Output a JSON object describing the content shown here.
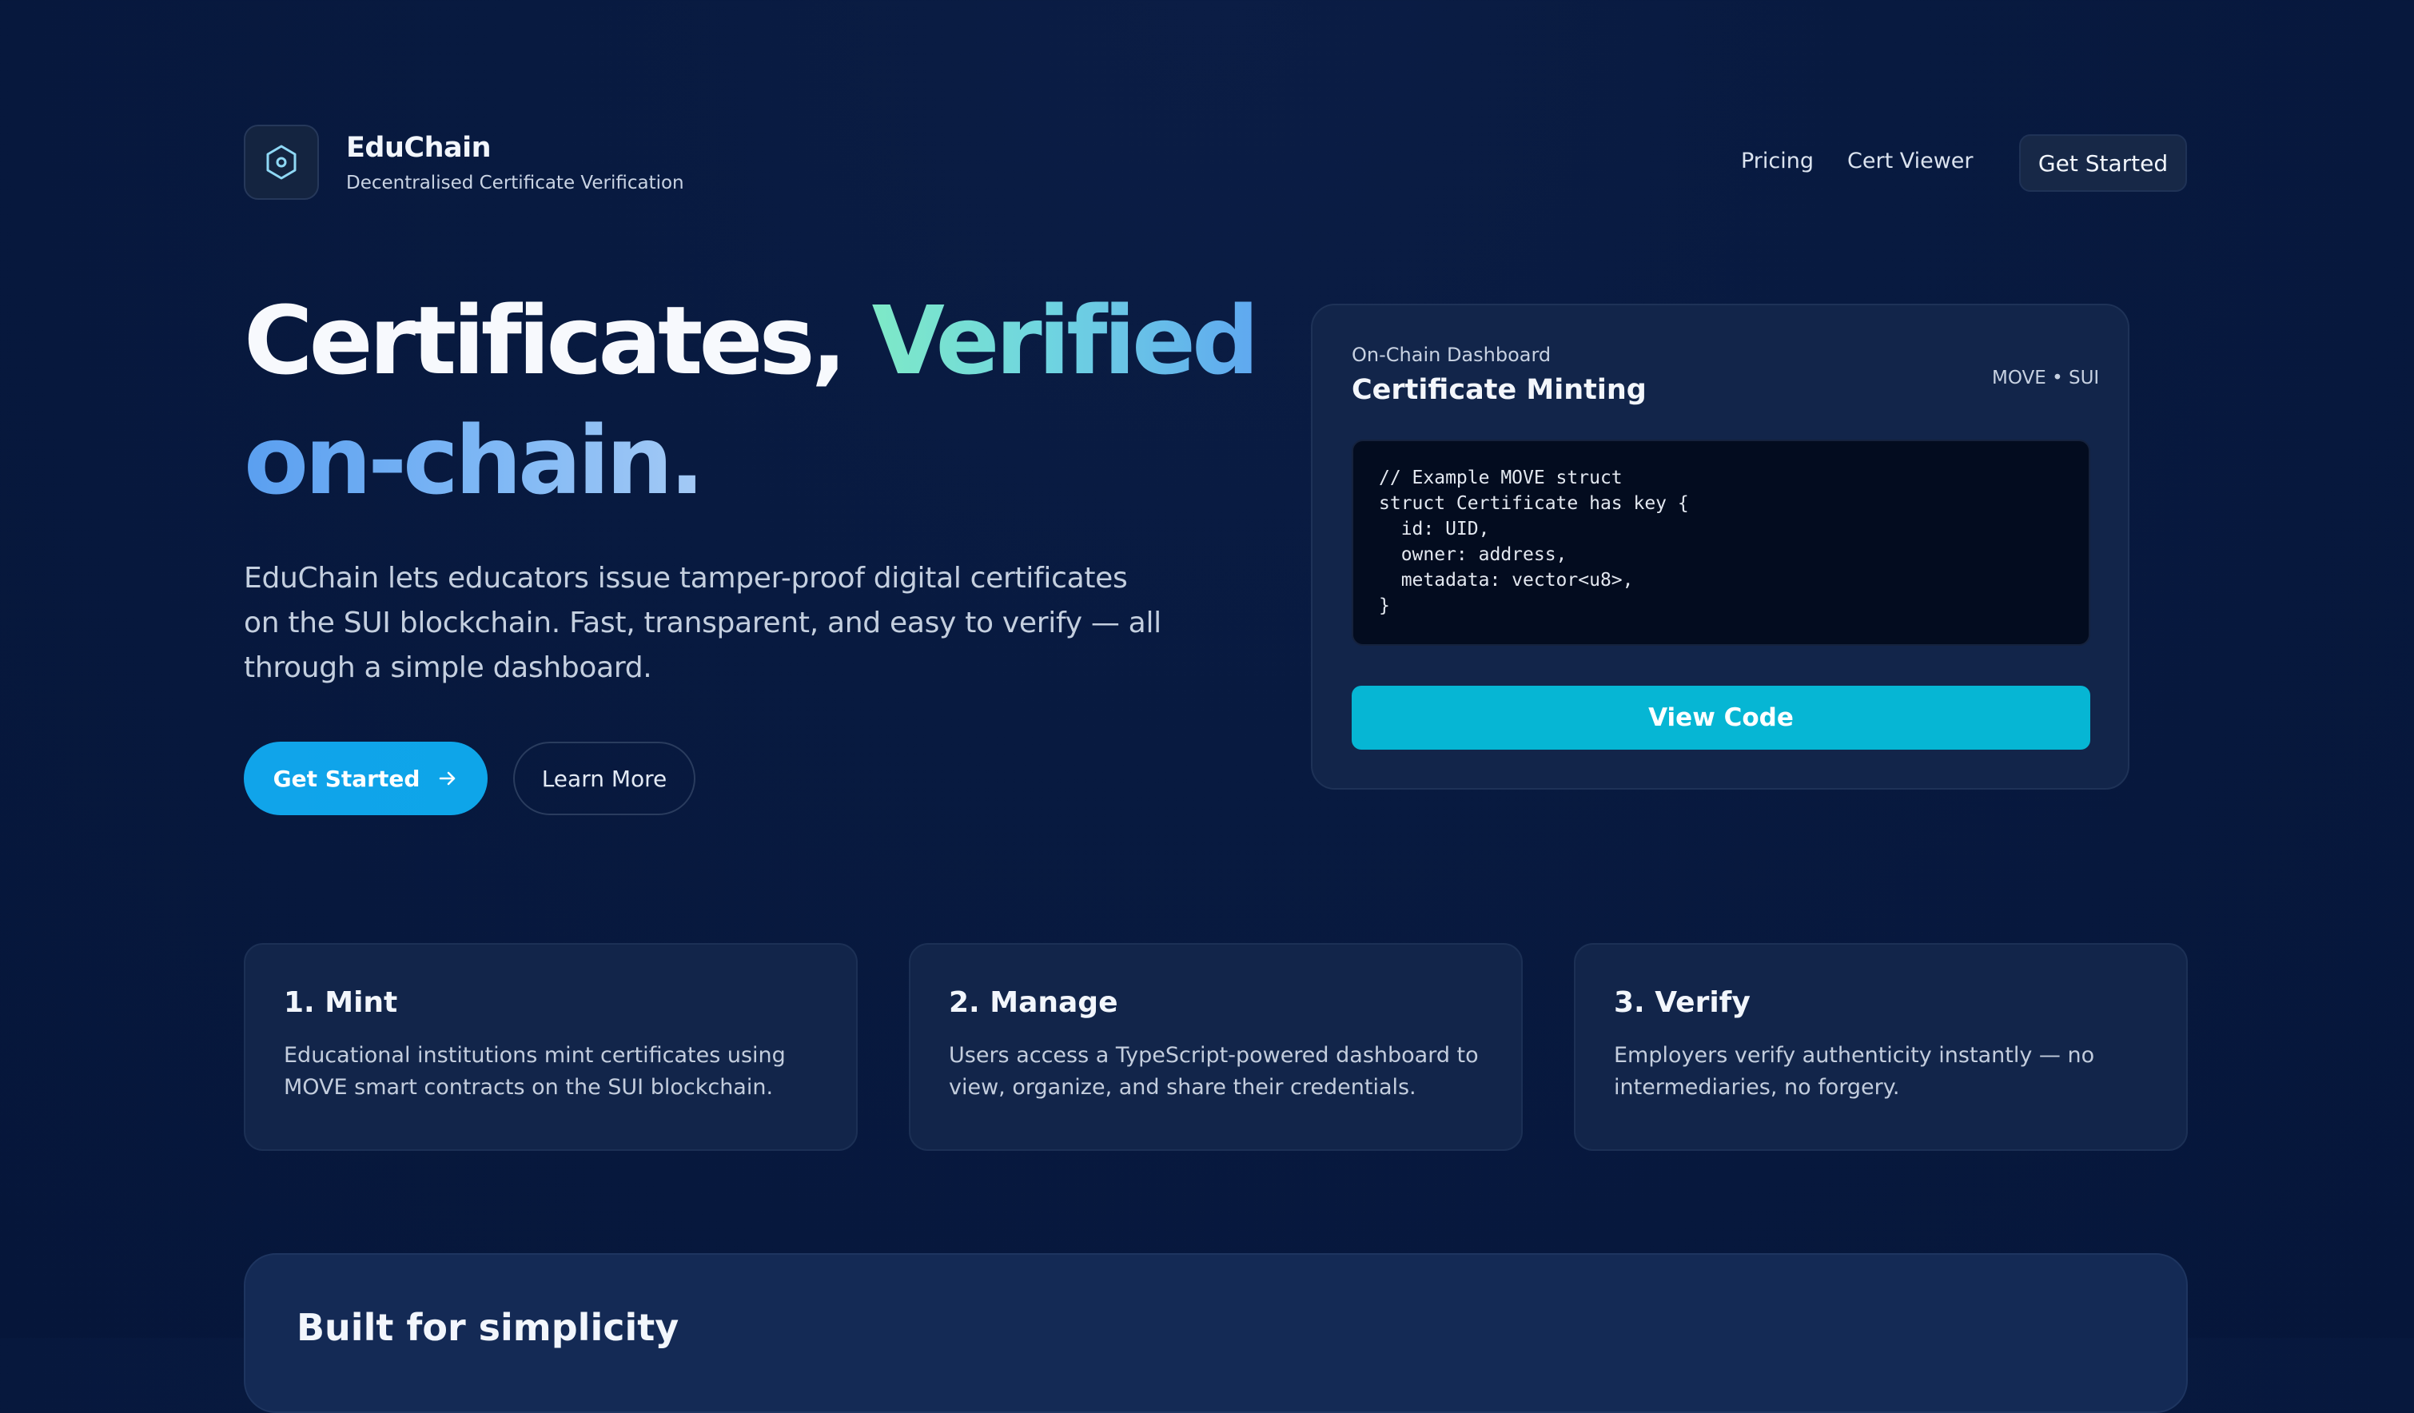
{
  "colors": {
    "background": "#071839",
    "accent_primary": "#0ea5e9",
    "accent_cyan": "#06b6d4",
    "card": "#12254a",
    "gradient_verified": [
      "#7ee9c7",
      "#5fa8f0"
    ],
    "gradient_onchain": [
      "#5a9ff0",
      "#a3c9f5"
    ]
  },
  "header": {
    "logo_icon": "hexagon-icon",
    "brand_name": "EduChain",
    "brand_tagline": "Decentralised Certificate Verification",
    "nav": {
      "pricing": "Pricing",
      "cert_viewer": "Cert Viewer",
      "get_started": "Get Started"
    }
  },
  "hero": {
    "title_part1": "Certificates,",
    "title_part2": "Verified",
    "title_part3": "on-chain.",
    "description": "EduChain lets educators issue tamper-proof digital certificates on the SUI blockchain. Fast, transparent, and easy to verify — all through a simple dashboard.",
    "primary_button": "Get Started",
    "primary_button_icon": "arrow-right-icon",
    "secondary_button": "Learn More"
  },
  "dashboard": {
    "kicker": "On-Chain Dashboard",
    "title": "Certificate Minting",
    "badge": "MOVE • SUI",
    "code_lines": [
      "// Example MOVE struct",
      "struct Certificate has key {",
      "  id: UID,",
      "  owner: address,",
      "  metadata: vector<u8>,",
      "}"
    ],
    "button": "View Code"
  },
  "steps": [
    {
      "title": "1. Mint",
      "text": "Educational institutions mint certificates using MOVE smart contracts on the SUI blockchain."
    },
    {
      "title": "2. Manage",
      "text": "Users access a TypeScript-powered dashboard to view, organize, and share their credentials."
    },
    {
      "title": "3. Verify",
      "text": "Employers verify authenticity instantly — no intermediaries, no forgery."
    }
  ],
  "bottom_section": {
    "title": "Built for simplicity"
  }
}
